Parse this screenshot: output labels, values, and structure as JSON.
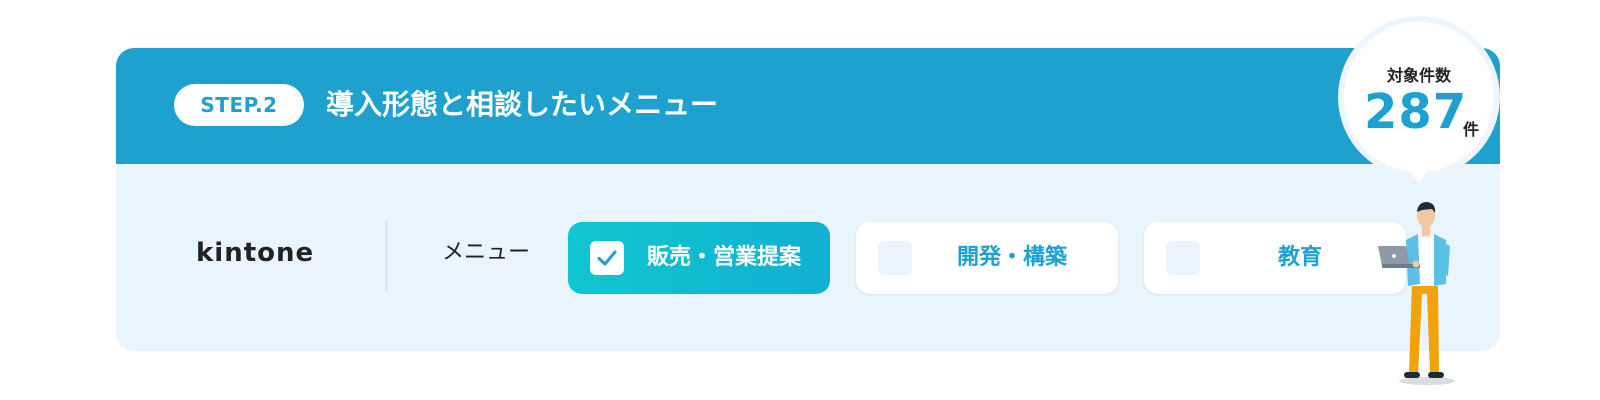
{
  "step": {
    "badge": "STEP.2",
    "title": "導入形態と相談したいメニュー"
  },
  "product": {
    "name": "kintone"
  },
  "menu": {
    "label": "メニュー",
    "options": [
      {
        "label": "販売・営業提案",
        "checked": true
      },
      {
        "label": "開発・構築",
        "checked": false
      },
      {
        "label": "教育",
        "checked": false
      }
    ]
  },
  "count": {
    "caption": "対象件数",
    "value": "287",
    "unit": "件"
  },
  "colors": {
    "primary": "#1fa1cf",
    "selected_gradient_start": "#11c6d0",
    "card_background": "#e9f4fc"
  },
  "icons": [
    "check-icon",
    "person-with-laptop-illustration"
  ]
}
